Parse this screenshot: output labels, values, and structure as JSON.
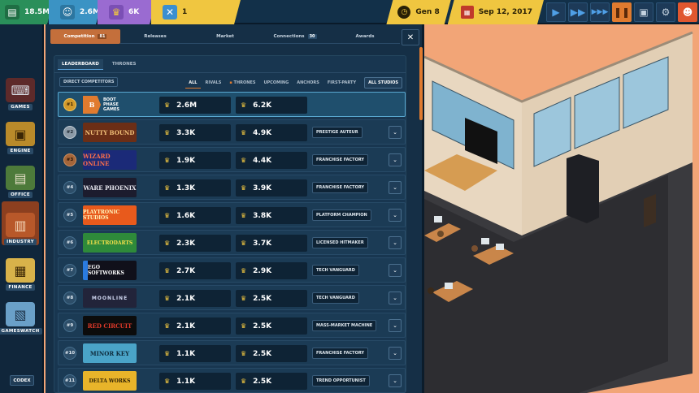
{
  "topbar": {
    "money": "18.5M",
    "fans": "2.6M",
    "crowns": "6K",
    "xp": "1",
    "generation": "Gen 8",
    "date": "Sep 12, 2017"
  },
  "sidebar": {
    "items": [
      {
        "label": "GAMES"
      },
      {
        "label": "ENGINE"
      },
      {
        "label": "OFFICE"
      },
      {
        "label": "INDUSTRY"
      },
      {
        "label": "FINANCE"
      },
      {
        "label": "GAMESWATCH"
      }
    ],
    "codex": "CODEX"
  },
  "tabs": [
    {
      "label": "Competition",
      "badge": "81"
    },
    {
      "label": "Releases"
    },
    {
      "label": "Market"
    },
    {
      "label": "Connections",
      "badge": "30"
    },
    {
      "label": "Awards"
    }
  ],
  "subtabs": [
    "LEADERBOARD",
    "THRONES"
  ],
  "direct_competitors": "DIRECT COMPETITORS",
  "filters": [
    "ALL",
    "RIVALS",
    "THRONES",
    "UPCOMING",
    "ANCHORS",
    "FIRST-PARTY"
  ],
  "all_studios": "ALL STUDIOS",
  "rows": [
    {
      "rank": "#1",
      "logo": "BOOT PHASE GAMES",
      "fans": "2.6M",
      "crowns": "6.2K",
      "tag": ""
    },
    {
      "rank": "#2",
      "logo": "NUTTY BOUND",
      "fans": "3.3K",
      "crowns": "4.9K",
      "tag": "PRESTIGE AUTEUR"
    },
    {
      "rank": "#3",
      "logo": "WIZARD ONLINE",
      "fans": "1.9K",
      "crowns": "4.4K",
      "tag": "FRANCHISE FACTORY"
    },
    {
      "rank": "#4",
      "logo": "WARE PHOENIX",
      "fans": "1.3K",
      "crowns": "3.9K",
      "tag": "FRANCHISE FACTORY"
    },
    {
      "rank": "#5",
      "logo": "PLAYTRONIC STUDIOS",
      "fans": "1.6K",
      "crowns": "3.8K",
      "tag": "PLATFORM CHAMPION"
    },
    {
      "rank": "#6",
      "logo": "ELECTRODARTS",
      "fans": "2.3K",
      "crowns": "3.7K",
      "tag": "LICENSED HITMAKER"
    },
    {
      "rank": "#7",
      "logo": "EGO SOFTWORKS",
      "fans": "2.7K",
      "crowns": "2.9K",
      "tag": "TECH VANGUARD"
    },
    {
      "rank": "#8",
      "logo": "MOONLINE",
      "fans": "2.1K",
      "crowns": "2.5K",
      "tag": "TECH VANGUARD"
    },
    {
      "rank": "#9",
      "logo": "RED CIRCUIT",
      "fans": "2.1K",
      "crowns": "2.5K",
      "tag": "MASS-MARKET MACHINE"
    },
    {
      "rank": "#10",
      "logo": "MINOR KEY",
      "fans": "1.1K",
      "crowns": "2.5K",
      "tag": "FRANCHISE FACTORY"
    },
    {
      "rank": "#11",
      "logo": "DELTA WORKS",
      "fans": "1.1K",
      "crowns": "2.5K",
      "tag": "TREND OPPORTUNIST"
    }
  ]
}
